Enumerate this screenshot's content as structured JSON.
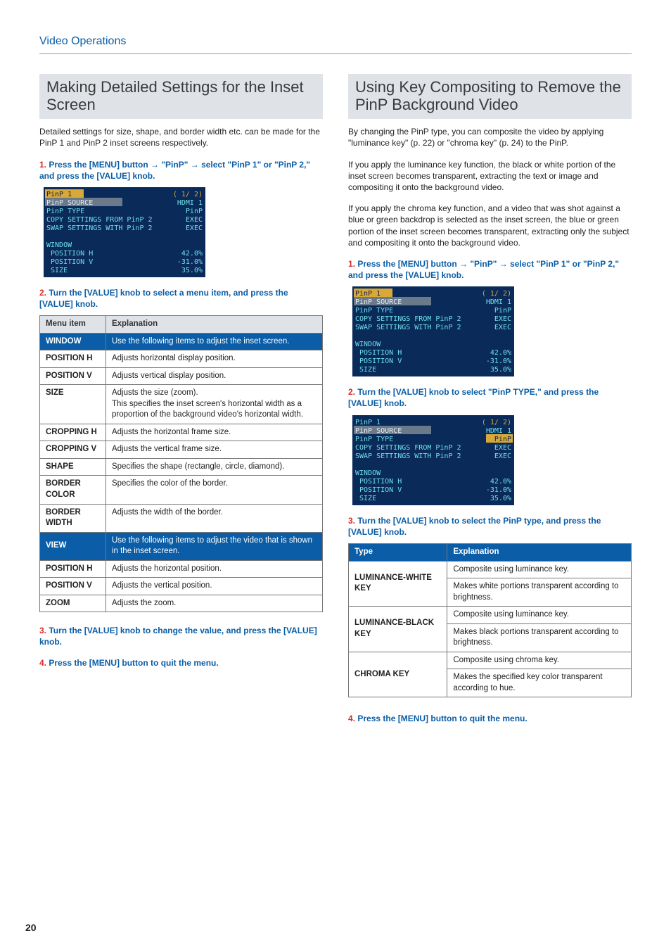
{
  "header": {
    "section": "Video Operations"
  },
  "page_number": "20",
  "left": {
    "title": "Making Detailed Settings for the Inset Screen",
    "lead": "Detailed settings for size, shape, and border width etc. can be made for the PinP 1 and PinP 2 inset screens respectively.",
    "steps": {
      "s1": {
        "num": "1.",
        "text": "Press the [MENU] button 0 \"PinP\" 0 select \"PinP 1\" or \"PinP 2,\" and press the [VALUE] knob."
      },
      "s2": {
        "num": "2.",
        "text": "Turn the [VALUE] knob to select a menu item, and press the [VALUE] knob."
      },
      "s3": {
        "num": "3.",
        "text": "Turn the [VALUE] knob to change the value, and press the [VALUE] knob."
      },
      "s4": {
        "num": "4.",
        "text": "Press the [MENU] button to quit the menu."
      }
    },
    "menu1": {
      "title": "PinP 1",
      "pages": "( 1/ 2)",
      "rows": [
        {
          "l": "PinP SOURCE",
          "r": "HDMI 1"
        },
        {
          "l": "PinP TYPE",
          "r": "PinP"
        },
        {
          "l": "COPY SETTINGS FROM PinP 2",
          "r": "EXEC"
        },
        {
          "l": "SWAP SETTINGS WITH PinP 2",
          "r": "EXEC"
        }
      ],
      "rows2": [
        {
          "l": "WINDOW",
          "r": ""
        },
        {
          "l": " POSITION H",
          "r": "42.0%"
        },
        {
          "l": " POSITION V",
          "r": "-31.0%"
        },
        {
          "l": " SIZE",
          "r": "35.0%"
        }
      ]
    },
    "table": {
      "head": {
        "c1": "Menu item",
        "c2": "Explanation"
      },
      "window": {
        "label": "WINDOW",
        "desc": "Use the following items to adjust the inset screen."
      },
      "rows1": [
        {
          "c1": "POSITION H",
          "c2": "Adjusts horizontal display position."
        },
        {
          "c1": "POSITION V",
          "c2": "Adjusts vertical display position."
        },
        {
          "c1": "SIZE",
          "c2": "Adjusts the size (zoom).\nThis specifies the inset screen's horizontal width as a proportion of the background video's horizontal width."
        },
        {
          "c1": "CROPPING H",
          "c2": "Adjusts the horizontal frame size."
        },
        {
          "c1": "CROPPING V",
          "c2": "Adjusts the vertical frame size."
        },
        {
          "c1": "SHAPE",
          "c2": "Specifies the shape (rectangle, circle, diamond)."
        },
        {
          "c1": "BORDER COLOR",
          "c2": "Specifies the color of the border."
        },
        {
          "c1": "BORDER WIDTH",
          "c2": "Adjusts the width of the border."
        }
      ],
      "view": {
        "label": "VIEW",
        "desc": "Use the following items to adjust the video that is shown in the inset screen."
      },
      "rows2": [
        {
          "c1": "POSITION H",
          "c2": "Adjusts the horizontal position."
        },
        {
          "c1": "POSITION V",
          "c2": "Adjusts the vertical position."
        },
        {
          "c1": "ZOOM",
          "c2": "Adjusts the zoom."
        }
      ]
    }
  },
  "right": {
    "title": "Using Key Compositing to Remove the PinP Background Video",
    "p1": "By changing the PinP type, you can composite the video by applying \"luminance key\" (p. 22) or \"chroma key\" (p. 24) to the PinP.",
    "p2": "If you apply the luminance key function, the black or white portion of the inset screen becomes transparent, extracting the text or image and compositing it onto the background video.",
    "p3": "If you apply the chroma key function, and a video that was shot against a blue or green backdrop is selected as the inset screen, the blue or green portion of the inset screen becomes transparent, extracting only the subject and compositing it onto the background video.",
    "steps": {
      "s1": {
        "num": "1.",
        "text": "Press the [MENU] button 0 \"PinP\" 0 select \"PinP 1\" or \"PinP 2,\" and press the [VALUE] knob."
      },
      "s2": {
        "num": "2.",
        "text": "Turn the [VALUE] knob to select \"PinP TYPE,\" and press the [VALUE] knob."
      },
      "s3": {
        "num": "3.",
        "text": "Turn the [VALUE] knob to select the PinP type, and press the [VALUE] knob."
      },
      "s4": {
        "num": "4.",
        "text": "Press the [MENU] button to quit the menu."
      }
    },
    "menu1": {
      "title": "PinP 1",
      "pages": "( 1/ 2)",
      "rows": [
        {
          "l": "PinP SOURCE",
          "r": "HDMI 1"
        },
        {
          "l": "PinP TYPE",
          "r": "PinP"
        },
        {
          "l": "COPY SETTINGS FROM PinP 2",
          "r": "EXEC"
        },
        {
          "l": "SWAP SETTINGS WITH PinP 2",
          "r": "EXEC"
        }
      ],
      "rows2": [
        {
          "l": "WINDOW",
          "r": ""
        },
        {
          "l": " POSITION H",
          "r": "42.0%"
        },
        {
          "l": " POSITION V",
          "r": "-31.0%"
        },
        {
          "l": " SIZE",
          "r": "35.0%"
        }
      ]
    },
    "menu2": {
      "title": "PinP 1",
      "pages": "( 1/ 2)",
      "rows": [
        {
          "l": "PinP SOURCE",
          "r": "HDMI 1"
        },
        {
          "l": "PinP TYPE",
          "r": "PinP",
          "hl": true
        },
        {
          "l": "COPY SETTINGS FROM PinP 2",
          "r": "EXEC"
        },
        {
          "l": "SWAP SETTINGS WITH PinP 2",
          "r": "EXEC"
        }
      ],
      "rows2": [
        {
          "l": "WINDOW",
          "r": ""
        },
        {
          "l": " POSITION H",
          "r": "42.0%"
        },
        {
          "l": " POSITION V",
          "r": "-31.0%"
        },
        {
          "l": " SIZE",
          "r": "35.0%"
        }
      ]
    },
    "table": {
      "head": {
        "c1": "Type",
        "c2": "Explanation"
      },
      "rows": [
        {
          "c1": "LUMINANCE-WHITE KEY",
          "a": "Composite using luminance key.",
          "b": "Makes white portions transparent according to brightness."
        },
        {
          "c1": "LUMINANCE-BLACK KEY",
          "a": "Composite using luminance key.",
          "b": "Makes black portions transparent according to brightness."
        },
        {
          "c1": "CHROMA KEY",
          "a": "Composite using chroma key.",
          "b": "Makes the specified key color transparent according to hue."
        }
      ]
    }
  }
}
